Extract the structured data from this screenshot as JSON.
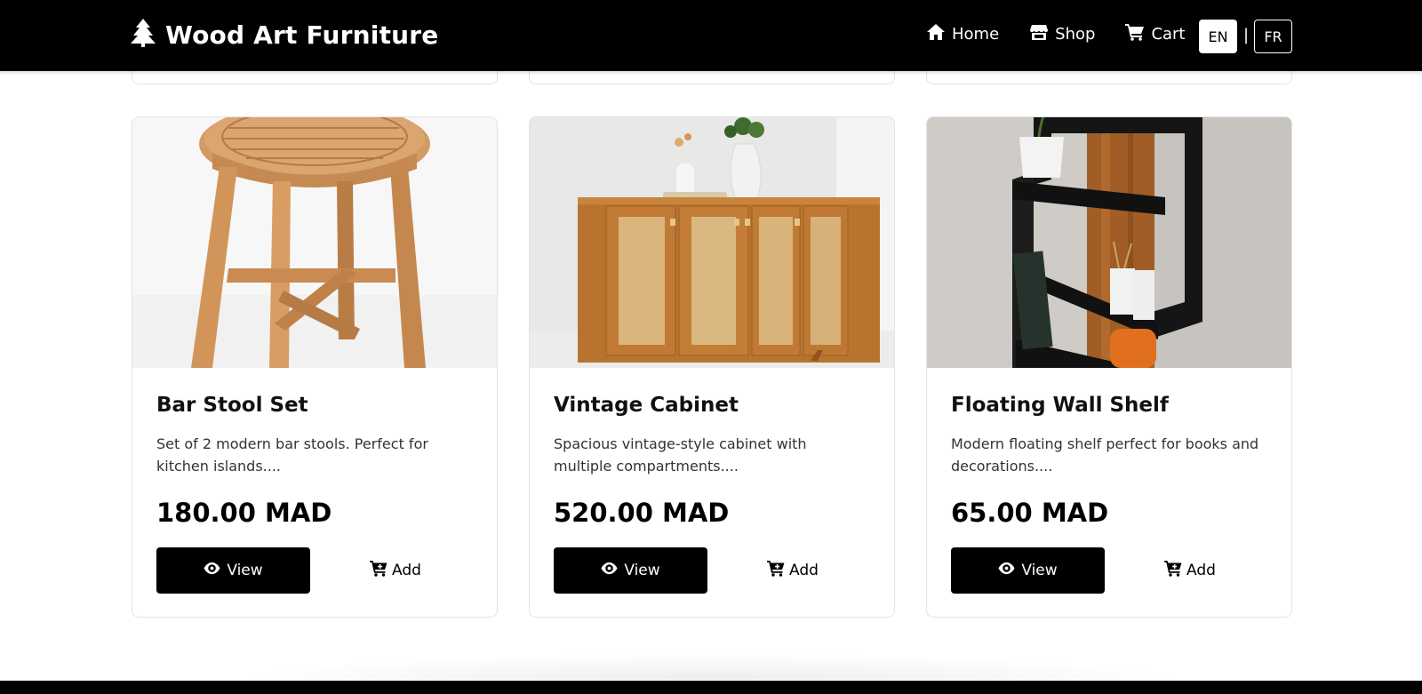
{
  "navbar": {
    "brand": "Wood Art Furniture",
    "brand_icon": "tree-icon",
    "links": [
      {
        "label": "Home",
        "icon": "home-icon"
      },
      {
        "label": "Shop",
        "icon": "store-icon"
      },
      {
        "label": "Cart",
        "icon": "cart-icon"
      }
    ],
    "languages": {
      "active": "EN",
      "separator": "|",
      "other": "FR"
    }
  },
  "products": [
    {
      "title": "Bar Stool Set",
      "description": "Set of 2 modern bar stools. Perfect for kitchen islands....",
      "price": "180.00 MAD",
      "view_label": "View",
      "add_label": "Add",
      "image": "wooden round stool"
    },
    {
      "title": "Vintage Cabinet",
      "description": "Spacious vintage-style cabinet with multiple compartments....",
      "price": "520.00 MAD",
      "view_label": "View",
      "add_label": "Add",
      "image": "rattan door wooden cabinet"
    },
    {
      "title": "Floating Wall Shelf",
      "description": "Modern floating shelf perfect for books and decorations....",
      "price": "65.00 MAD",
      "view_label": "View",
      "add_label": "Add",
      "image": "black wall shelf on wood panel"
    }
  ],
  "colors": {
    "navbar_bg": "#000000",
    "button_bg": "#000000",
    "card_border": "#e3e3e3",
    "wood": "#c98b52"
  }
}
